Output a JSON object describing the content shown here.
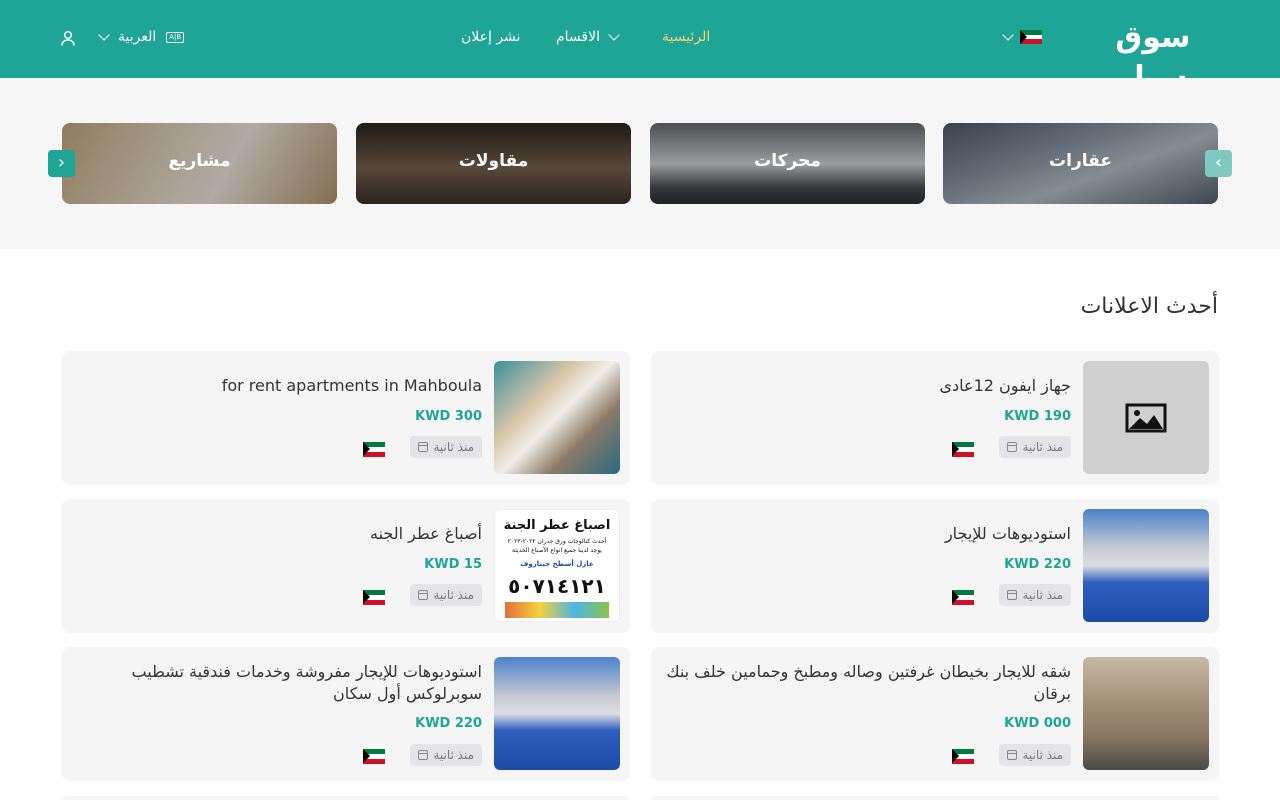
{
  "header": {
    "logo": "سوق سيل",
    "nav": {
      "home": "الرئيسية",
      "categories": "الاقسام",
      "post_ad": "نشر إعلان"
    },
    "language": "العربية",
    "language_badge": "A|B"
  },
  "categories": [
    {
      "label": "عقارات"
    },
    {
      "label": "محركات"
    },
    {
      "label": "مقاولات"
    },
    {
      "label": "مشاريع"
    }
  ],
  "arrows": {
    "prev": "‹",
    "next": "›"
  },
  "section_title": "أحدث الاعلانات",
  "listings": [
    {
      "title": "جهاز ايفون 12عادى",
      "price": "KWD 190",
      "time": "منذ ثانية",
      "image": "placeholder"
    },
    {
      "title": "for rent apartments in Mahboula",
      "price": "KWD 300",
      "time": "منذ ثانية",
      "image": "apartment-collage"
    },
    {
      "title": "استوديوهات للإيجار",
      "price": "KWD 220",
      "time": "منذ ثانية",
      "image": "studio-room"
    },
    {
      "title": "أصباغ عطر الجنه",
      "price": "KWD 15",
      "time": "منذ ثانية",
      "image": "paint-ad"
    },
    {
      "title": "شقه للايجار بخيطان غرفتين وصاله ومطبخ وحمامين خلف بنك برقان",
      "price": "KWD 000",
      "time": "منذ ثانية",
      "image": "building"
    },
    {
      "title": "استوديوهات للإيجار مفروشة وخدمات فندقية تشطيب سوبرلوكس أول سكان",
      "price": "KWD 220",
      "time": "منذ ثانية",
      "image": "studio-room"
    }
  ],
  "paint_ad": {
    "heading": "اصباغ عطر الجنة",
    "line1": "أحدث كتالوجات ورق جدران ٢٠٢٢-٢٠٢٣",
    "line2": "يوجد لدينا جميع انواع الأصباغ الحديثة",
    "line3": "عازل أسطح جيتاروف",
    "phone": "٥٠٧١٤١٢١"
  },
  "colors": {
    "brand": "#1fa596",
    "nav_active": "#f5d76e",
    "price": "#1fa596"
  },
  "icons": {
    "user": "user-icon",
    "calendar": "calendar-icon",
    "chevron": "chevron-down-icon",
    "image_placeholder": "image-icon"
  }
}
